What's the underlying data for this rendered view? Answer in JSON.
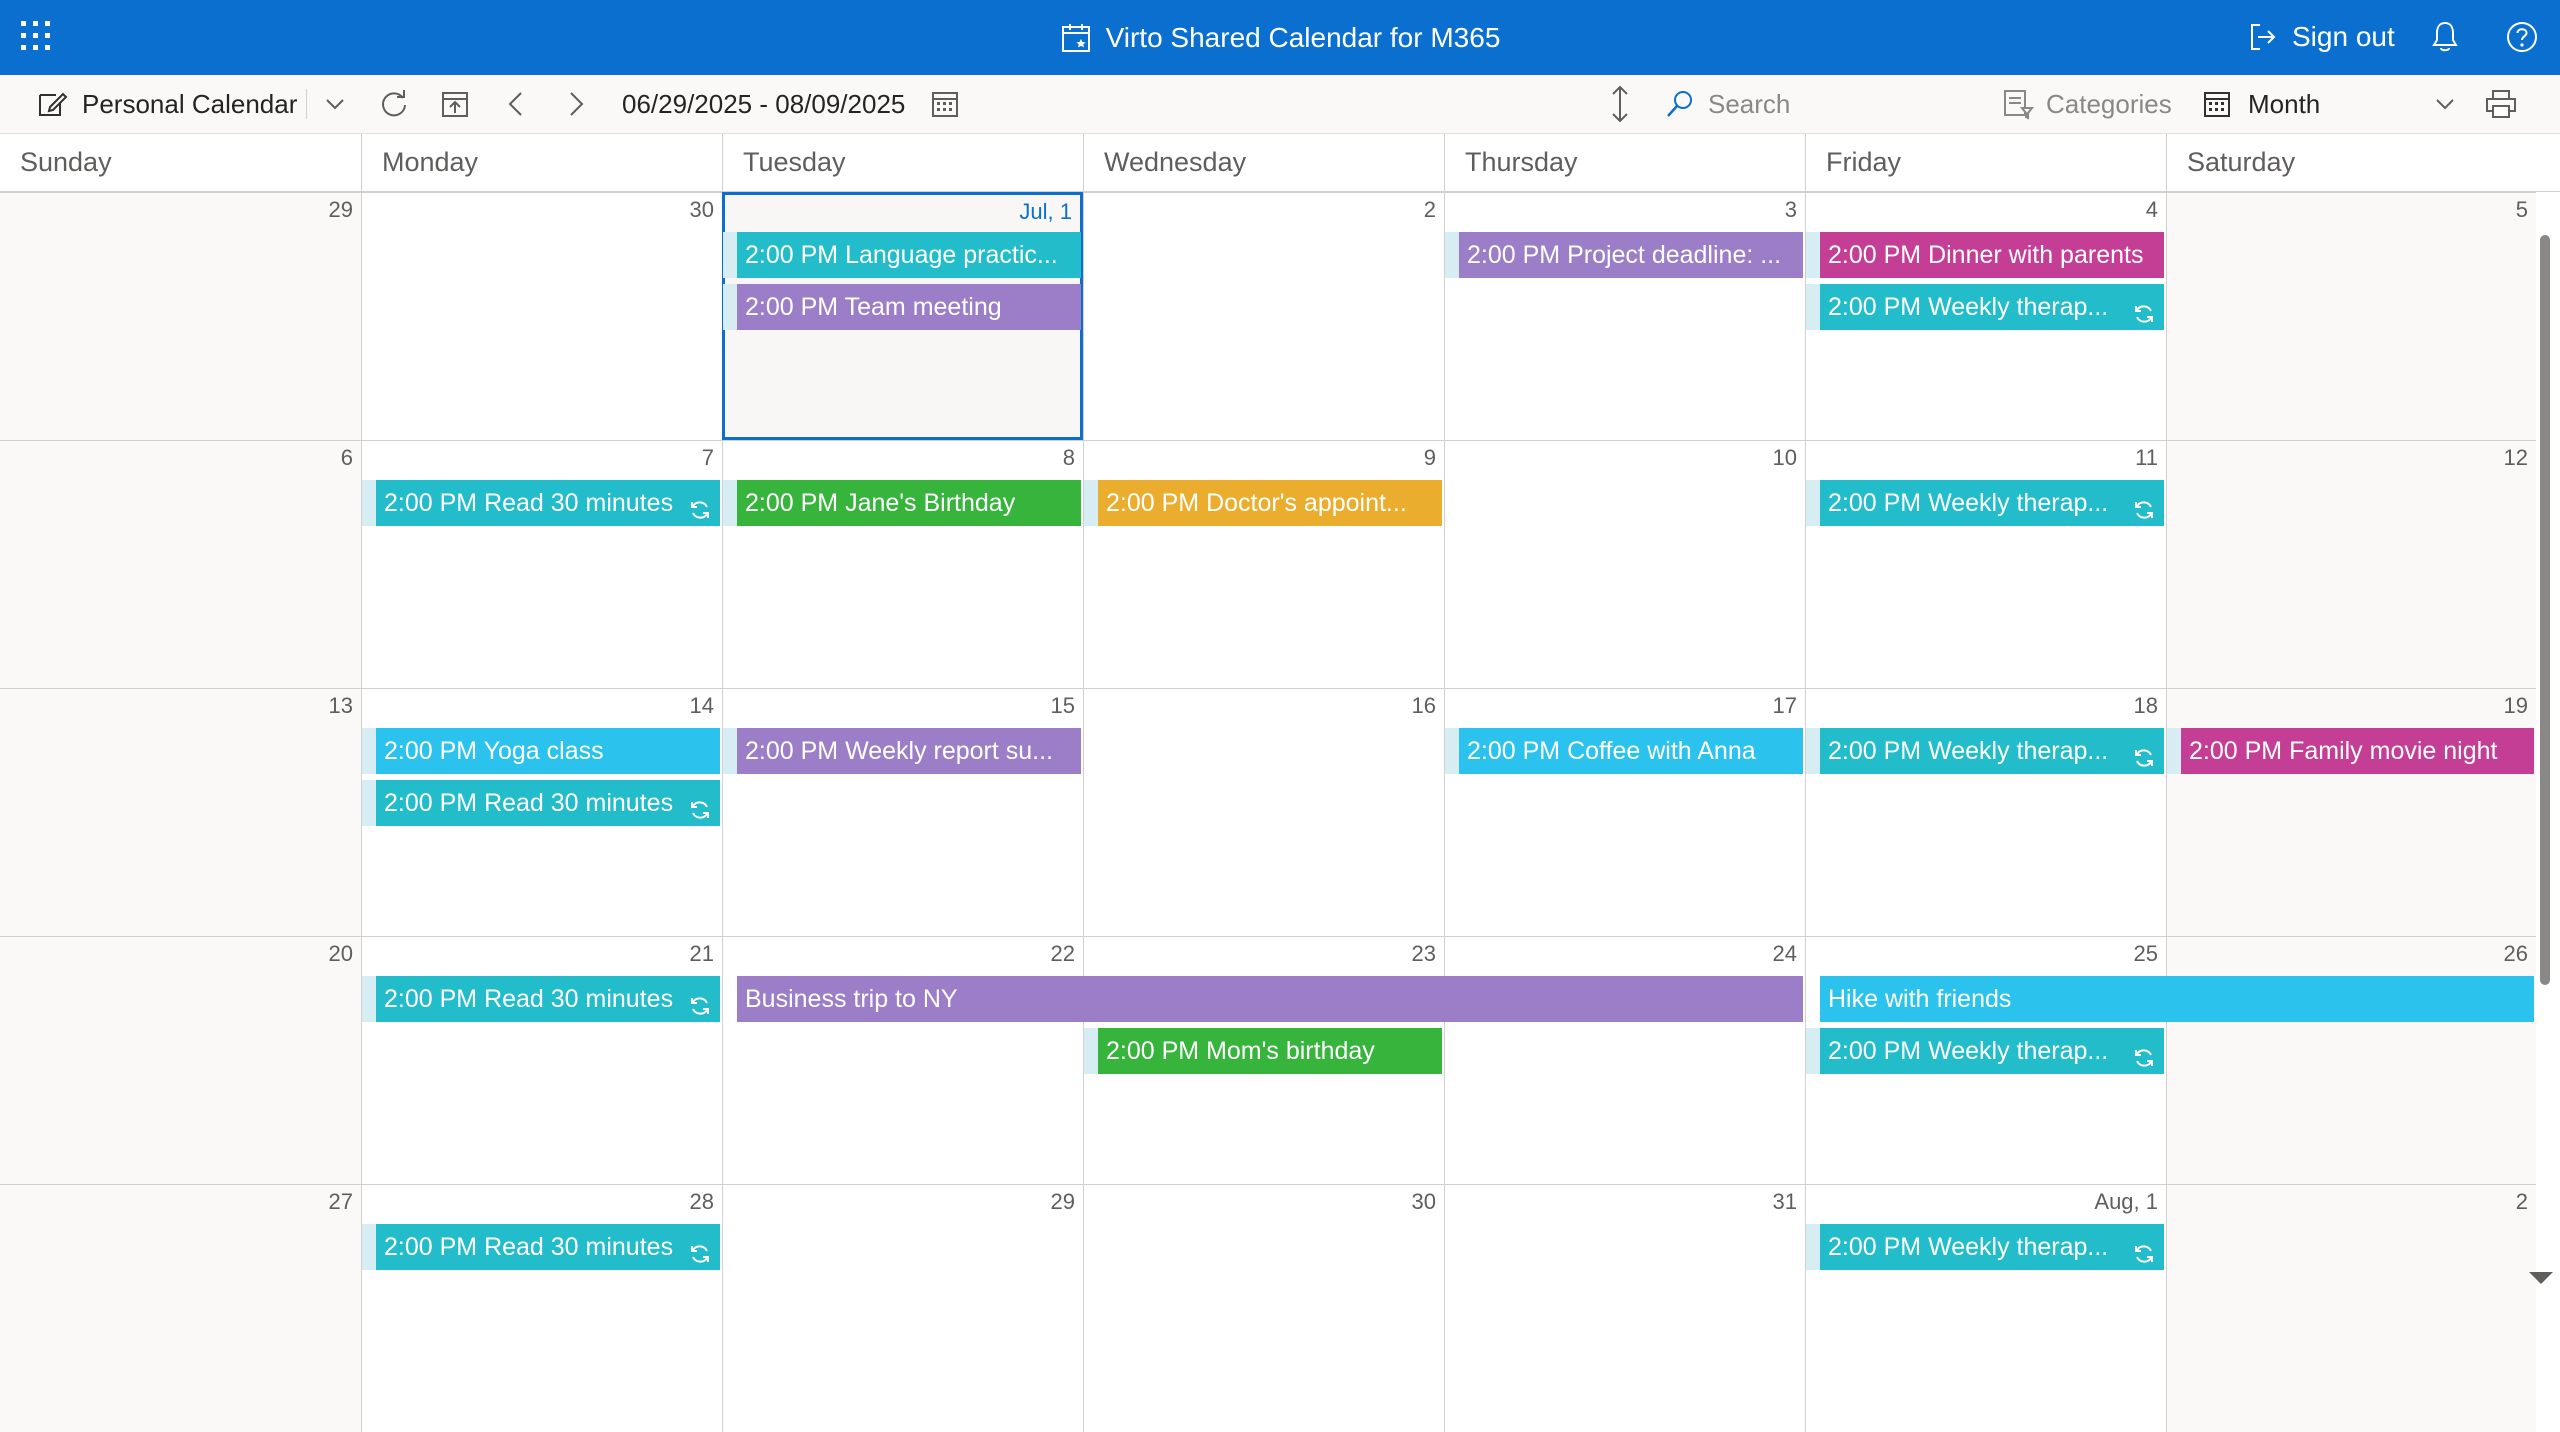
{
  "app": {
    "title": "Virto Shared Calendar for M365",
    "sign_out": "Sign out",
    "accent": "#0a6fcf"
  },
  "toolbar": {
    "calendar_name": "Personal Calendar",
    "date_range": "06/29/2025 - 08/09/2025",
    "search_placeholder": "Search",
    "categories_label": "Categories",
    "view_label": "Month"
  },
  "day_names": [
    "Sunday",
    "Monday",
    "Tuesday",
    "Wednesday",
    "Thursday",
    "Friday",
    "Saturday"
  ],
  "weeks": [
    [
      "29",
      "30",
      "Jul, 1",
      "2",
      "3",
      "4",
      "5"
    ],
    [
      "6",
      "7",
      "8",
      "9",
      "10",
      "11",
      "12"
    ],
    [
      "13",
      "14",
      "15",
      "16",
      "17",
      "18",
      "19"
    ],
    [
      "20",
      "21",
      "22",
      "23",
      "24",
      "25",
      "26"
    ],
    [
      "27",
      "28",
      "29",
      "30",
      "31",
      "Aug, 1",
      "2"
    ]
  ],
  "today": {
    "week": 0,
    "day": 2
  },
  "colors": {
    "teal": "#23bcca",
    "purple": "#9b7dc8",
    "pink": "#c43e96",
    "green": "#36b43c",
    "orange": "#eaad2d",
    "blue": "#2bc3ee"
  },
  "events": [
    {
      "week": 0,
      "day": 2,
      "span": 1,
      "row": 0,
      "time": "2:00 PM",
      "title": "Language practic...",
      "color": "teal",
      "recurring": false
    },
    {
      "week": 0,
      "day": 2,
      "span": 1,
      "row": 1,
      "time": "2:00 PM",
      "title": "Team meeting",
      "color": "purple",
      "recurring": false
    },
    {
      "week": 0,
      "day": 4,
      "span": 1,
      "row": 0,
      "time": "2:00 PM",
      "title": "Project deadline: ...",
      "color": "purple",
      "recurring": false
    },
    {
      "week": 0,
      "day": 5,
      "span": 1,
      "row": 0,
      "time": "2:00 PM",
      "title": "Dinner with parents",
      "color": "pink",
      "recurring": false
    },
    {
      "week": 0,
      "day": 5,
      "span": 1,
      "row": 1,
      "time": "2:00 PM",
      "title": "Weekly therap...",
      "color": "teal",
      "recurring": true
    },
    {
      "week": 1,
      "day": 1,
      "span": 1,
      "row": 0,
      "time": "2:00 PM",
      "title": "Read 30 minutes",
      "color": "teal",
      "recurring": true
    },
    {
      "week": 1,
      "day": 2,
      "span": 1,
      "row": 0,
      "time": "2:00 PM",
      "title": "Jane's Birthday",
      "color": "green",
      "recurring": false
    },
    {
      "week": 1,
      "day": 3,
      "span": 1,
      "row": 0,
      "time": "2:00 PM",
      "title": "Doctor's appoint...",
      "color": "orange",
      "recurring": false
    },
    {
      "week": 1,
      "day": 5,
      "span": 1,
      "row": 0,
      "time": "2:00 PM",
      "title": "Weekly therap...",
      "color": "teal",
      "recurring": true
    },
    {
      "week": 2,
      "day": 1,
      "span": 1,
      "row": 0,
      "time": "2:00 PM",
      "title": "Yoga class",
      "color": "blue",
      "recurring": false
    },
    {
      "week": 2,
      "day": 1,
      "span": 1,
      "row": 1,
      "time": "2:00 PM",
      "title": "Read 30 minutes",
      "color": "teal",
      "recurring": true
    },
    {
      "week": 2,
      "day": 2,
      "span": 1,
      "row": 0,
      "time": "2:00 PM",
      "title": "Weekly report su...",
      "color": "purple",
      "recurring": false
    },
    {
      "week": 2,
      "day": 4,
      "span": 1,
      "row": 0,
      "time": "2:00 PM",
      "title": "Coffee with Anna",
      "color": "blue",
      "recurring": false
    },
    {
      "week": 2,
      "day": 5,
      "span": 1,
      "row": 0,
      "time": "2:00 PM",
      "title": "Weekly therap...",
      "color": "teal",
      "recurring": true
    },
    {
      "week": 2,
      "day": 6,
      "span": 1,
      "row": 0,
      "time": "2:00 PM",
      "title": "Family movie night",
      "color": "pink",
      "recurring": false
    },
    {
      "week": 3,
      "day": 1,
      "span": 1,
      "row": 0,
      "time": "2:00 PM",
      "title": "Read 30 minutes",
      "color": "teal",
      "recurring": true
    },
    {
      "week": 3,
      "day": 2,
      "span": 3,
      "row": 0,
      "time": "",
      "title": "Business trip to NY",
      "color": "purple",
      "recurring": false
    },
    {
      "week": 3,
      "day": 5,
      "span": 2,
      "row": 0,
      "time": "",
      "title": "Hike with friends",
      "color": "blue",
      "recurring": false
    },
    {
      "week": 3,
      "day": 3,
      "span": 1,
      "row": 1,
      "time": "2:00 PM",
      "title": "Mom's birthday",
      "color": "green",
      "recurring": false
    },
    {
      "week": 3,
      "day": 5,
      "span": 1,
      "row": 1,
      "time": "2:00 PM",
      "title": "Weekly therap...",
      "color": "teal",
      "recurring": true
    },
    {
      "week": 4,
      "day": 1,
      "span": 1,
      "row": 0,
      "time": "2:00 PM",
      "title": "Read 30 minutes",
      "color": "teal",
      "recurring": true
    },
    {
      "week": 4,
      "day": 5,
      "span": 1,
      "row": 0,
      "time": "2:00 PM",
      "title": "Weekly therap...",
      "color": "teal",
      "recurring": true
    }
  ]
}
